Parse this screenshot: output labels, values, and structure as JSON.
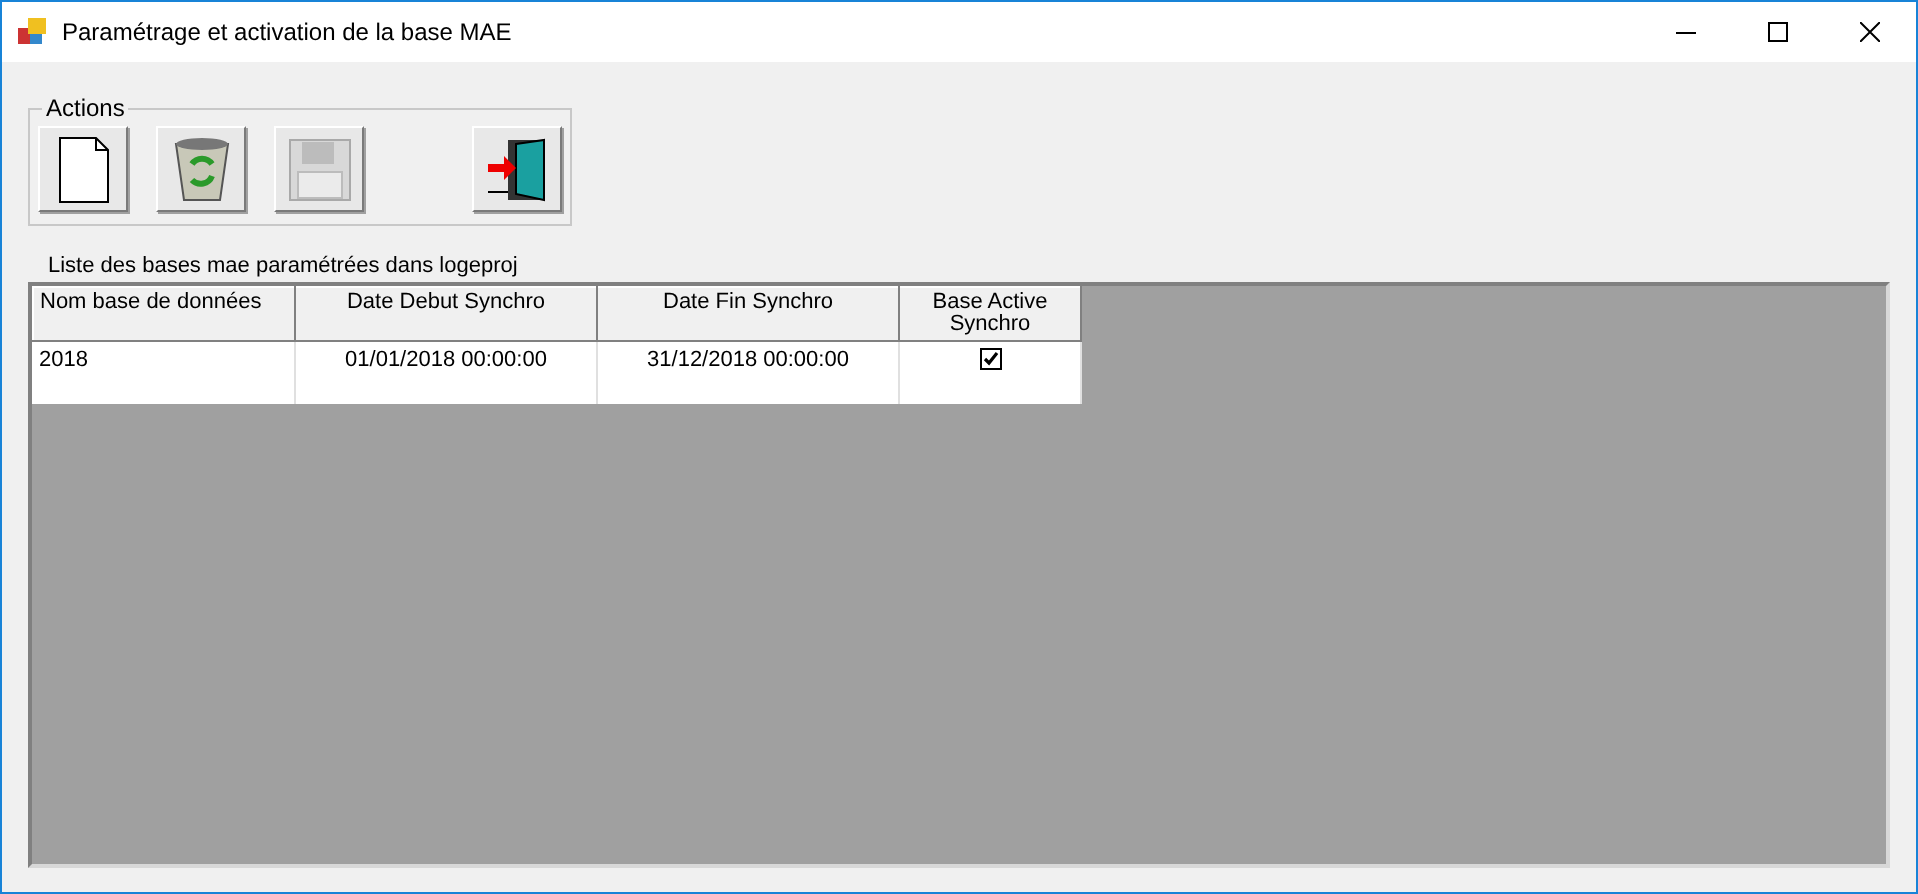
{
  "window": {
    "title": "Paramétrage et activation de la base MAE"
  },
  "actions": {
    "label": "Actions",
    "buttons": [
      {
        "kind": "new",
        "disabled": false
      },
      {
        "kind": "recycle",
        "disabled": false
      },
      {
        "kind": "save",
        "disabled": true
      },
      {
        "kind": "exit",
        "disabled": false
      }
    ]
  },
  "list_label": "Liste des bases mae paramétrées dans logeproj",
  "table": {
    "columns": [
      {
        "label": "Nom base de données"
      },
      {
        "label": "Date Debut Synchro"
      },
      {
        "label": "Date Fin Synchro"
      },
      {
        "label": "Base Active Synchro"
      }
    ],
    "rows": [
      {
        "name": "2018",
        "start": "01/01/2018 00:00:00",
        "end": "31/12/2018 00:00:00",
        "active": true
      }
    ]
  }
}
